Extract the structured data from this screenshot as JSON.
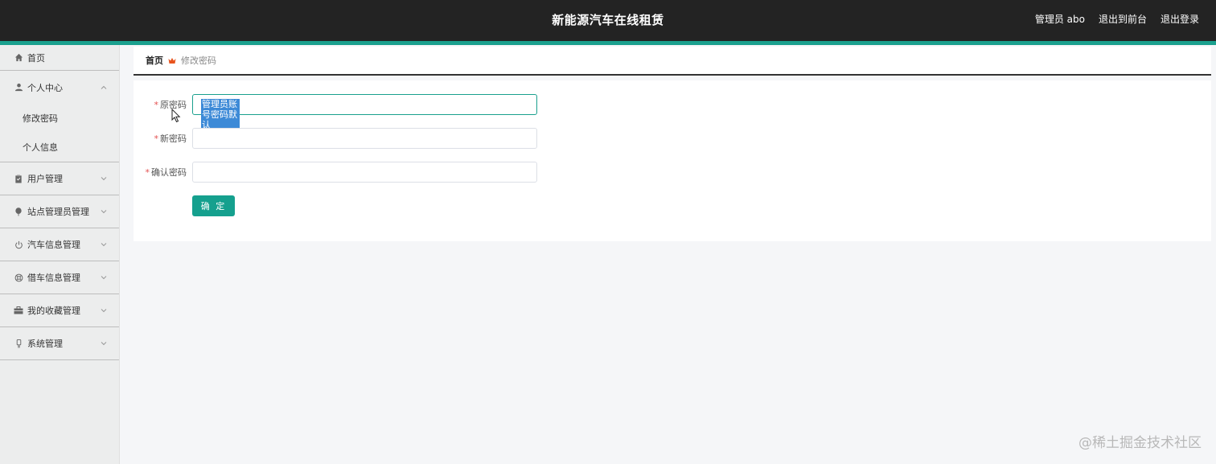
{
  "header": {
    "title": "新能源汽车在线租赁",
    "user_label": "管理员 abo",
    "to_frontend": "退出到前台",
    "logout": "退出登录"
  },
  "sidebar": {
    "items": [
      {
        "label": "首页",
        "icon": "home-icon"
      },
      {
        "label": "个人中心",
        "icon": "user-icon",
        "expanded": true,
        "children": [
          {
            "label": "修改密码"
          },
          {
            "label": "个人信息"
          }
        ]
      },
      {
        "label": "用户管理",
        "icon": "clipboard-icon"
      },
      {
        "label": "站点管理员管理",
        "icon": "balloon-icon"
      },
      {
        "label": "汽车信息管理",
        "icon": "power-icon"
      },
      {
        "label": "借车信息管理",
        "icon": "lifebuoy-icon"
      },
      {
        "label": "我的收藏管理",
        "icon": "briefcase-icon"
      },
      {
        "label": "系统管理",
        "icon": "bulb-icon"
      }
    ]
  },
  "breadcrumb": {
    "home": "首页",
    "current": "修改密码"
  },
  "form": {
    "old_password": {
      "label": "原密码",
      "value": "管理员账号密码默认abo_abo"
    },
    "new_password": {
      "label": "新密码",
      "value": ""
    },
    "confirm_password": {
      "label": "确认密码",
      "value": ""
    },
    "submit": "确 定"
  },
  "watermark": "@稀土掘金技术社区",
  "colors": {
    "accent": "#1aa08e",
    "header_bg": "#232323",
    "selection": "#3d8ad7"
  }
}
